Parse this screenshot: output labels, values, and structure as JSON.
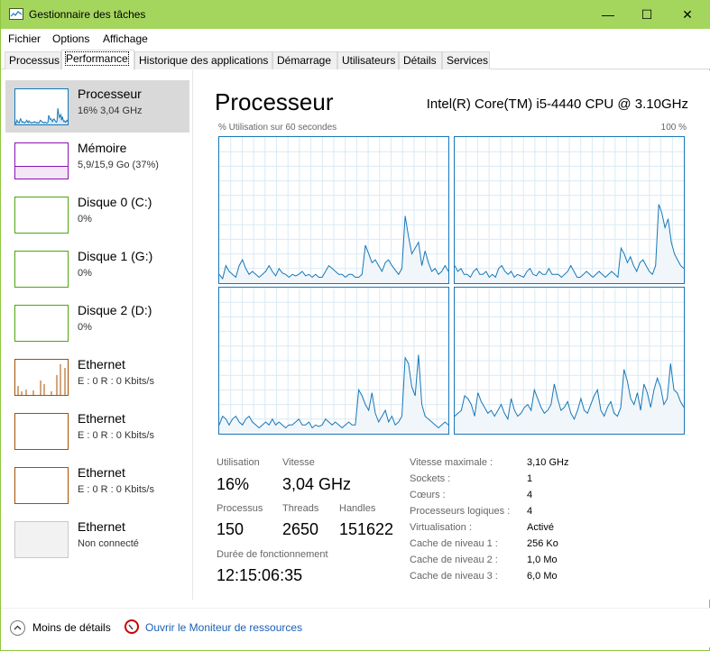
{
  "window": {
    "title": "Gestionnaire des tâches",
    "controls": {
      "minimize": "—",
      "maximize": "☐",
      "close": "✕"
    }
  },
  "menu": [
    "Fichier",
    "Options",
    "Affichage"
  ],
  "tabs": [
    {
      "label": "Processus",
      "active": false
    },
    {
      "label": "Performance",
      "active": true
    },
    {
      "label": "Historique des applications",
      "active": false
    },
    {
      "label": "Démarrage",
      "active": false
    },
    {
      "label": "Utilisateurs",
      "active": false
    },
    {
      "label": "Détails",
      "active": false
    },
    {
      "label": "Services",
      "active": false
    }
  ],
  "sidebar": [
    {
      "name": "Processeur",
      "sub": "16% 3,04 GHz",
      "color": "#1778b8",
      "selected": true
    },
    {
      "name": "Mémoire",
      "sub": "5,9/15,9 Go (37%)",
      "color": "#8b12ae",
      "selected": false
    },
    {
      "name": "Disque 0 (C:)",
      "sub": "0%",
      "color": "#4da60c",
      "selected": false
    },
    {
      "name": "Disque 1 (G:)",
      "sub": "0%",
      "color": "#4da60c",
      "selected": false
    },
    {
      "name": "Disque 2 (D:)",
      "sub": "0%",
      "color": "#4da60c",
      "selected": false
    },
    {
      "name": "Ethernet",
      "sub": "E : 0 R : 0 Kbits/s",
      "color": "#a74f01",
      "selected": false
    },
    {
      "name": "Ethernet",
      "sub": "E : 0 R : 0 Kbits/s",
      "color": "#a74f01",
      "selected": false
    },
    {
      "name": "Ethernet",
      "sub": "E : 0 R : 0 Kbits/s",
      "color": "#a74f01",
      "selected": false
    },
    {
      "name": "Ethernet",
      "sub": "Non connecté",
      "color": "#c8c8c8",
      "selected": false
    }
  ],
  "main": {
    "title": "Processeur",
    "model": "Intel(R) Core(TM) i5-4440 CPU @ 3.10GHz",
    "graph_label_left": "% Utilisation sur 60 secondes",
    "graph_label_right": "100 %"
  },
  "chart_data": {
    "type": "area",
    "y_range": [
      0,
      100
    ],
    "series": [
      {
        "values": [
          6,
          3,
          12,
          8,
          6,
          4,
          12,
          16,
          10,
          6,
          8,
          6,
          4,
          6,
          8,
          12,
          8,
          5,
          10,
          7,
          6,
          4,
          6,
          5,
          6,
          8,
          5,
          6,
          4,
          6,
          4,
          4,
          8,
          12,
          10,
          8,
          6,
          6,
          4,
          6,
          6,
          4,
          4,
          6,
          26,
          20,
          14,
          16,
          12,
          8,
          14,
          16,
          12,
          9,
          6,
          10,
          46,
          32,
          20,
          24,
          28,
          12,
          22,
          14,
          8,
          10,
          6,
          8,
          12,
          8
        ]
      },
      {
        "values": [
          12,
          8,
          10,
          6,
          6,
          4,
          8,
          10,
          6,
          6,
          8,
          4,
          6,
          4,
          10,
          12,
          8,
          6,
          8,
          4,
          6,
          5,
          4,
          8,
          10,
          6,
          5,
          8,
          6,
          6,
          10,
          6,
          6,
          6,
          4,
          6,
          8,
          12,
          8,
          4,
          4,
          6,
          8,
          6,
          4,
          6,
          8,
          6,
          4,
          6,
          8,
          6,
          4,
          24,
          20,
          14,
          18,
          12,
          8,
          14,
          16,
          12,
          8,
          6,
          12,
          54,
          48,
          38,
          44,
          28,
          20,
          16,
          12,
          10
        ]
      },
      {
        "values": [
          6,
          12,
          10,
          6,
          10,
          12,
          8,
          6,
          10,
          12,
          8,
          6,
          4,
          6,
          8,
          6,
          10,
          6,
          8,
          6,
          4,
          6,
          6,
          8,
          10,
          6,
          6,
          8,
          4,
          6,
          5,
          6,
          10,
          8,
          6,
          8,
          6,
          4,
          6,
          8,
          6,
          6,
          30,
          26,
          20,
          16,
          28,
          14,
          8,
          12,
          16,
          8,
          12,
          6,
          8,
          12,
          52,
          48,
          32,
          26,
          54,
          20,
          12,
          10,
          8,
          6,
          4,
          6,
          8,
          6
        ]
      },
      {
        "values": [
          12,
          14,
          16,
          26,
          24,
          20,
          12,
          28,
          22,
          18,
          14,
          16,
          12,
          16,
          20,
          14,
          10,
          24,
          16,
          12,
          14,
          18,
          20,
          16,
          30,
          24,
          18,
          14,
          16,
          20,
          34,
          24,
          16,
          18,
          22,
          14,
          10,
          16,
          24,
          16,
          14,
          20,
          26,
          30,
          16,
          12,
          18,
          22,
          14,
          12,
          18,
          44,
          36,
          24,
          20,
          28,
          16,
          34,
          28,
          18,
          30,
          38,
          32,
          20,
          24,
          48,
          30,
          28,
          22,
          18
        ]
      }
    ]
  },
  "stats": {
    "utilisation": {
      "label": "Utilisation",
      "value": "16%"
    },
    "vitesse": {
      "label": "Vitesse",
      "value": "3,04 GHz"
    },
    "processus": {
      "label": "Processus",
      "value": "150"
    },
    "threads": {
      "label": "Threads",
      "value": "2650"
    },
    "handles": {
      "label": "Handles",
      "value": "151622"
    },
    "duree": {
      "label": "Durée de fonctionnement",
      "value": "12:15:06:35"
    }
  },
  "details": [
    {
      "label": "Vitesse maximale :",
      "value": "3,10 GHz"
    },
    {
      "label": "Sockets :",
      "value": "1"
    },
    {
      "label": "Cœurs :",
      "value": "4"
    },
    {
      "label": "Processeurs logiques :",
      "value": "4"
    },
    {
      "label": "Virtualisation :",
      "value": "Activé"
    },
    {
      "label": "Cache de niveau 1 :",
      "value": "256 Ko"
    },
    {
      "label": "Cache de niveau 2 :",
      "value": "1,0 Mo"
    },
    {
      "label": "Cache de niveau 3 :",
      "value": "6,0 Mo"
    }
  ],
  "footer": {
    "less_details": "Moins de détails",
    "resource_monitor": "Ouvrir le Moniteur de ressources"
  }
}
